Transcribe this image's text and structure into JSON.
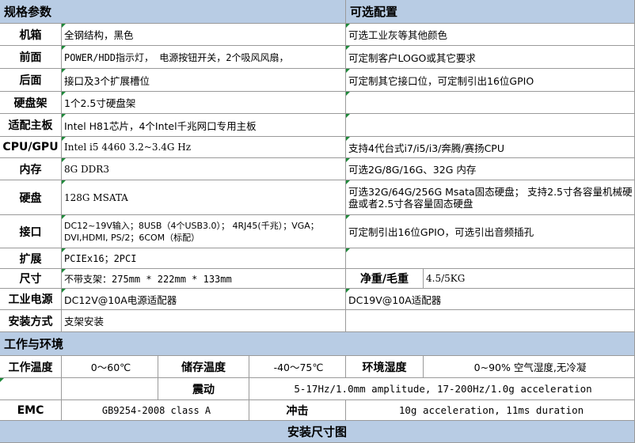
{
  "header": {
    "spec_title": "规格参数",
    "option_title": "可选配置"
  },
  "rows": [
    {
      "label": "机箱",
      "spec": "全钢结构，黑色",
      "option": "可选工业灰等其他颜色"
    },
    {
      "label": "前面",
      "spec": "POWER/HDD指示灯， 电源按钮开关，2个吸风风扇，",
      "option": "可定制客户LOGO或其它要求"
    },
    {
      "label": "后面",
      "spec": "接口及3个扩展槽位",
      "option": "可定制其它接口位，可定制引出16位GPIO"
    },
    {
      "label": "硬盘架",
      "spec": "1个2.5寸硬盘架",
      "option": ""
    },
    {
      "label": "适配主板",
      "spec": "Intel H81芯片，4个Intel千兆网口专用主板",
      "option": ""
    },
    {
      "label": "CPU/GPU",
      "spec": "Intel i5 4460 3.2~3.4G Hz",
      "option": "支持4代台式i7/i5/i3/奔腾/赛扬CPU"
    },
    {
      "label": "内存",
      "spec": "8G DDR3",
      "option": "可选2G/8G/16G、32G 内存"
    },
    {
      "label": "硬盘",
      "spec": "128G MSATA",
      "option": "可选32G/64G/256G Msata固态硬盘； 支持2.5寸各容量机械硬盘或者2.5寸各容量固态硬盘"
    },
    {
      "label": "接口",
      "spec": "DC12~19V输入；8USB（4个USB3.0）； 4RJ45(千兆）；VGA；DVI,HDMI, PS/2；6COM（标配）",
      "option": "可定制引出16位GPIO，可选引出音频插孔"
    },
    {
      "label": "扩展",
      "spec": "PCIEx16；2PCI",
      "option": ""
    },
    {
      "label": "尺寸",
      "spec": "不带支架：275mm  * 222mm * 133mm",
      "option_label": "净重/毛重",
      "option_value": "4.5/5KG"
    },
    {
      "label": "工业电源",
      "spec": "DC12V@10A电源适配器",
      "option": "DC19V@10A适配器"
    },
    {
      "label": "安装方式",
      "spec": "支架安装",
      "option": ""
    }
  ],
  "env": {
    "title": "工作与环境",
    "work_temp_label": "工作温度",
    "work_temp_value": "0～60℃",
    "storage_temp_label": "储存温度",
    "storage_temp_value": "-40～75℃",
    "humidity_label": "环境湿度",
    "humidity_value": "0~90% 空气湿度,无冷凝",
    "vibration_label": "震动",
    "vibration_value": "5-17Hz/1.0mm amplitude, 17-200Hz/1.0g acceleration",
    "emc_label": "EMC",
    "emc_value": "GB9254-2008 class A",
    "shock_label": "冲击",
    "shock_value": "10g acceleration, 11ms duration"
  },
  "footer": {
    "title": "安装尺寸图"
  },
  "colors": {
    "header_bg": "#b8cce4",
    "border": "#9a9a9a",
    "marker": "#1e8a3a"
  }
}
